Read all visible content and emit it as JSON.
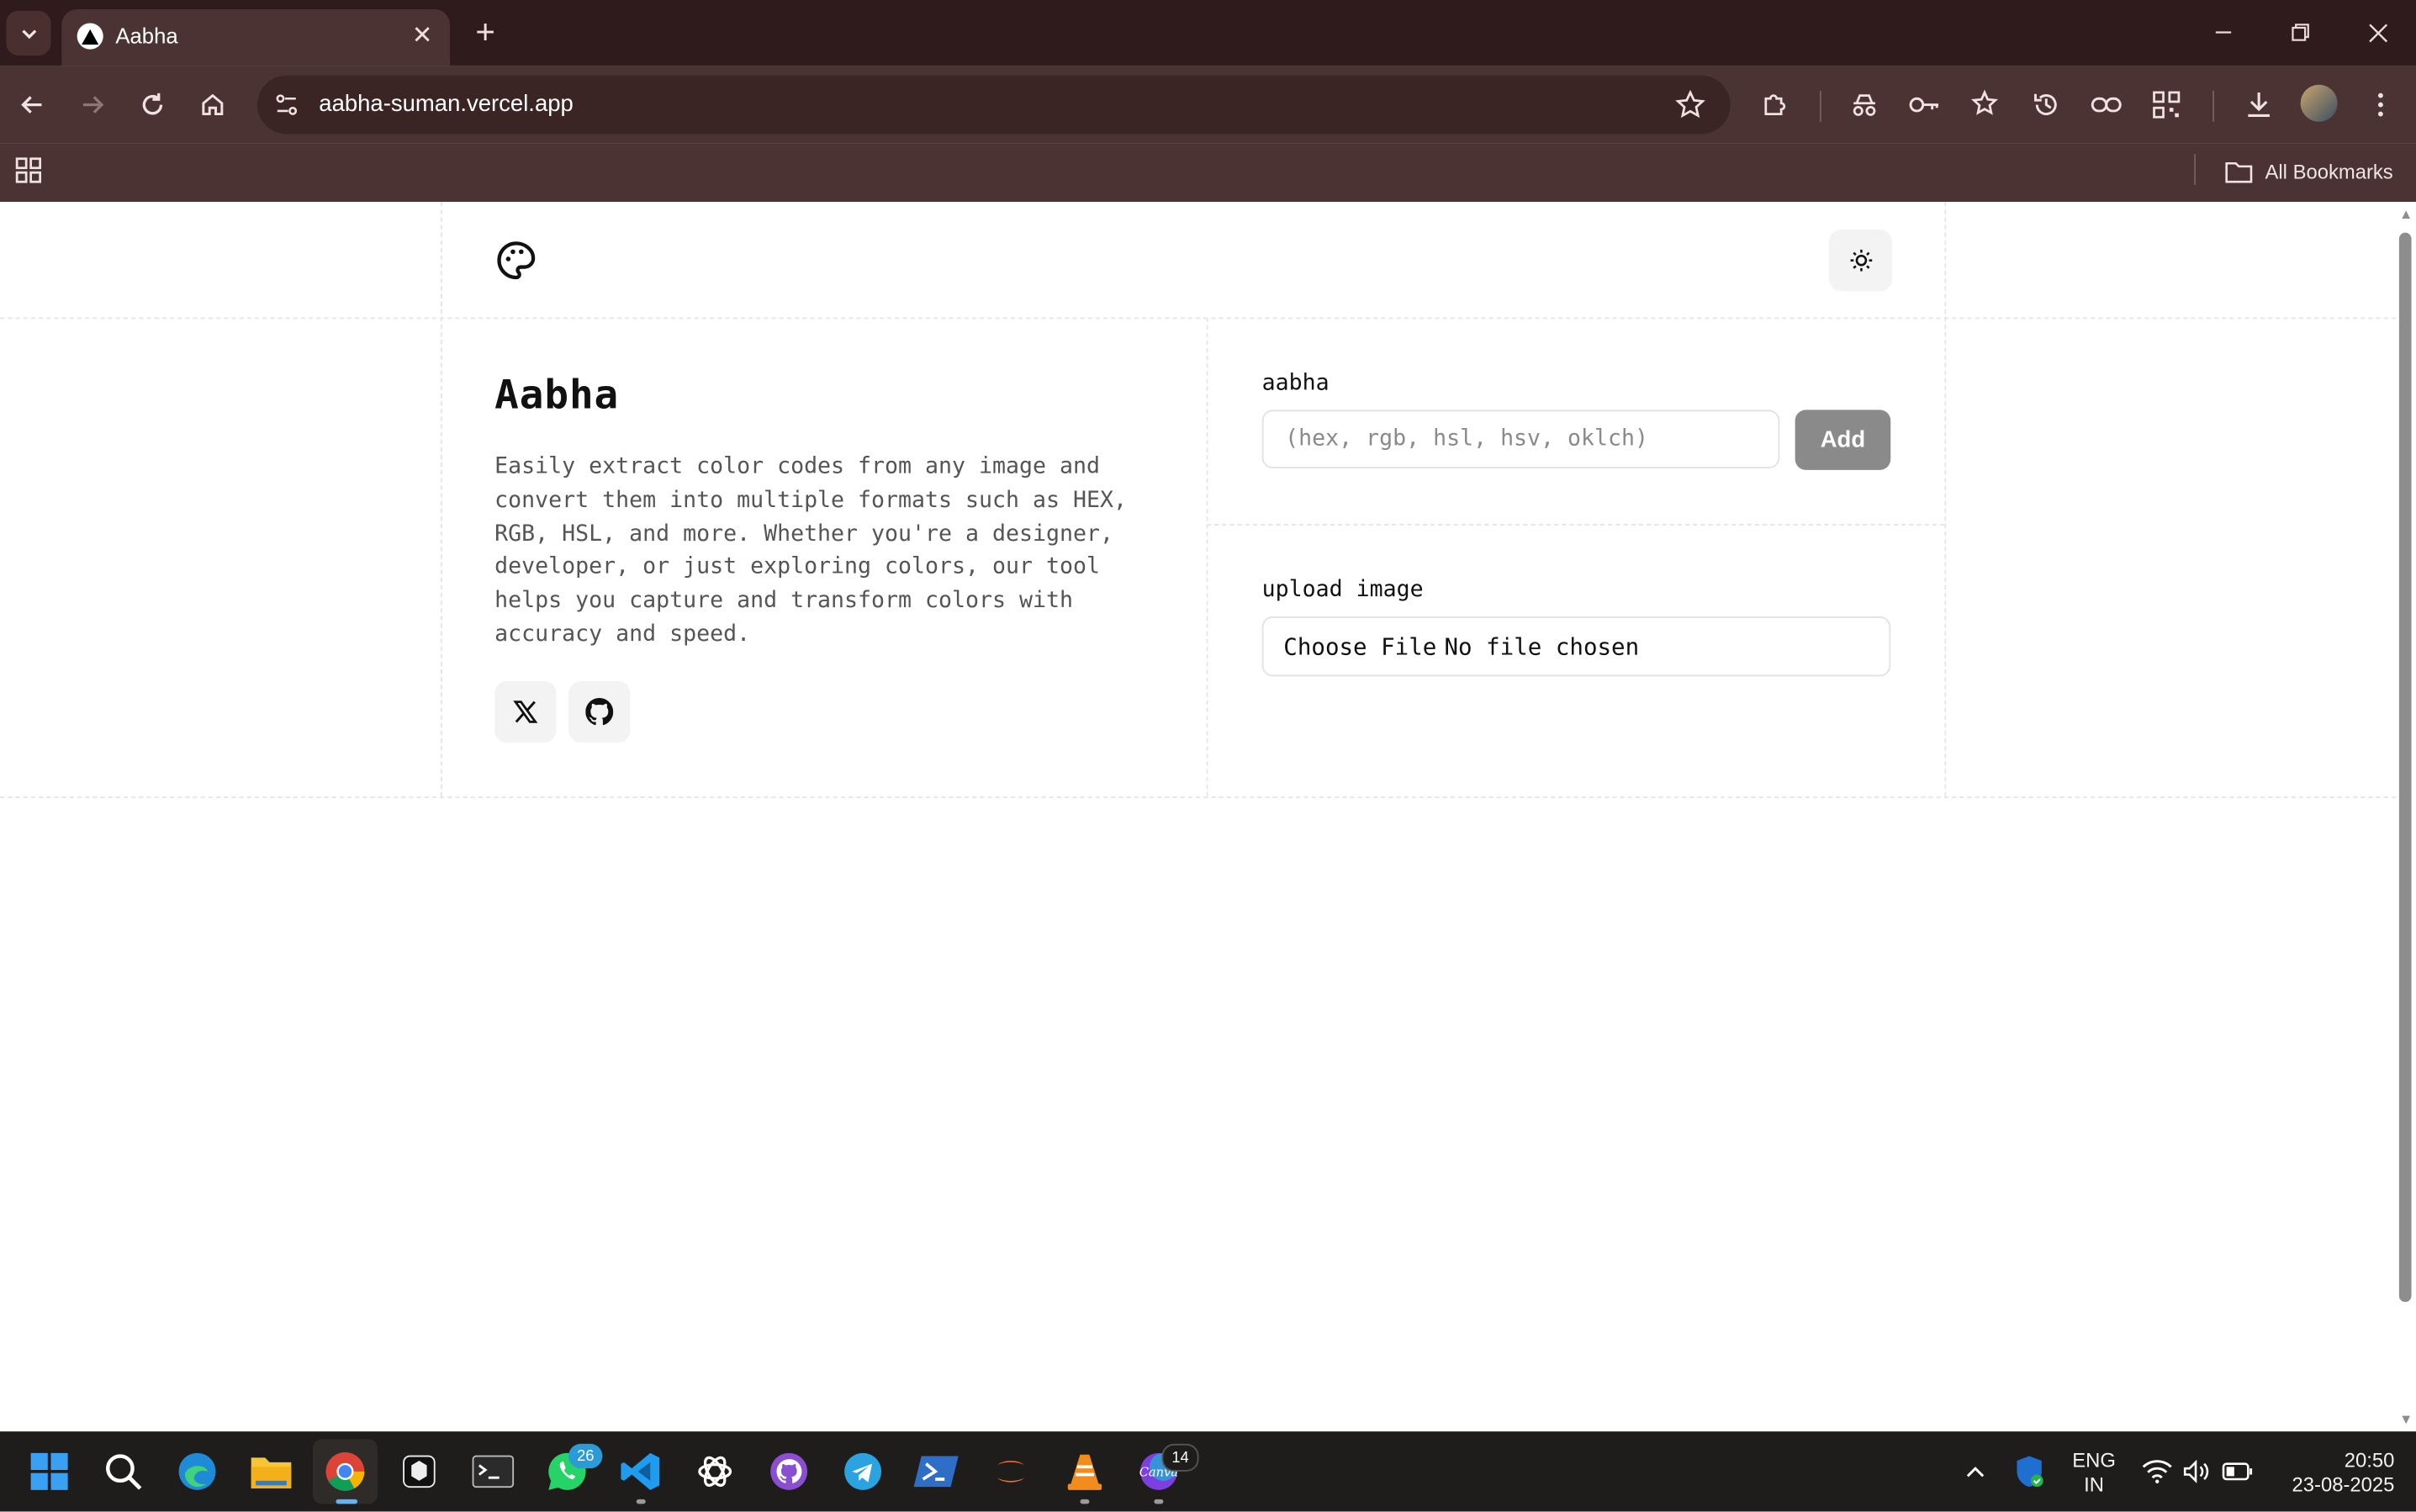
{
  "browser": {
    "tab_title": "Aabha",
    "url": "aabha-suman.vercel.app",
    "bookmarks_label": "All Bookmarks"
  },
  "app": {
    "title": "Aabha",
    "description": "Easily extract color codes from any image and convert them into multiple formats such as HEX, RGB, HSL, and more. Whether you're a designer, developer, or just exploring colors, our tool helps you capture and transform colors with accuracy and speed.",
    "color_input": {
      "label": "aabha",
      "placeholder": "(hex, rgb, hsl, hsv, oklch)",
      "value": "",
      "add_label": "Add"
    },
    "upload": {
      "label": "upload image",
      "button_label": "Choose File",
      "status": "No file chosen"
    },
    "social": [
      "x-icon",
      "github-icon"
    ]
  },
  "taskbar": {
    "apps": [
      "windows-start",
      "search",
      "edge",
      "file-explorer",
      "chrome",
      "app-box",
      "terminal",
      "whatsapp",
      "vscode",
      "chatgpt",
      "github-desktop",
      "telegram",
      "powershell",
      "jupyter",
      "vlc",
      "canva"
    ],
    "whatsapp_badge": "26",
    "canva_badge": "14",
    "lang_line1": "ENG",
    "lang_line2": "IN",
    "time": "20:50",
    "date": "23-08-2025"
  }
}
